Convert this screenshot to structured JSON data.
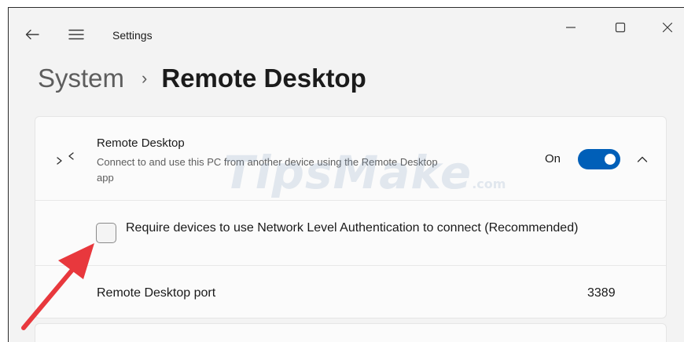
{
  "window": {
    "app_title": "Settings"
  },
  "breadcrumb": {
    "parent": "System",
    "separator": "›",
    "current": "Remote Desktop"
  },
  "remote_desktop": {
    "title": "Remote Desktop",
    "description": "Connect to and use this PC from another device using the Remote Desktop app",
    "toggle_state": "On",
    "toggle_on": true,
    "accent_color": "#005fb8"
  },
  "nla": {
    "label": "Require devices to use Network Level Authentication to connect (Recommended)",
    "checked": false
  },
  "port": {
    "label": "Remote Desktop port",
    "value": "3389"
  },
  "watermark": {
    "text": "TipsMake",
    "suffix": ".com"
  },
  "annotation": {
    "arrow_color": "#e8383d"
  },
  "icons": {
    "back": "back-arrow-icon",
    "menu": "hamburger-menu-icon",
    "minimize": "minimize-icon",
    "maximize": "maximize-icon",
    "close": "close-icon",
    "remote_desktop": "remote-desktop-icon",
    "expand": "chevron-up-icon"
  }
}
